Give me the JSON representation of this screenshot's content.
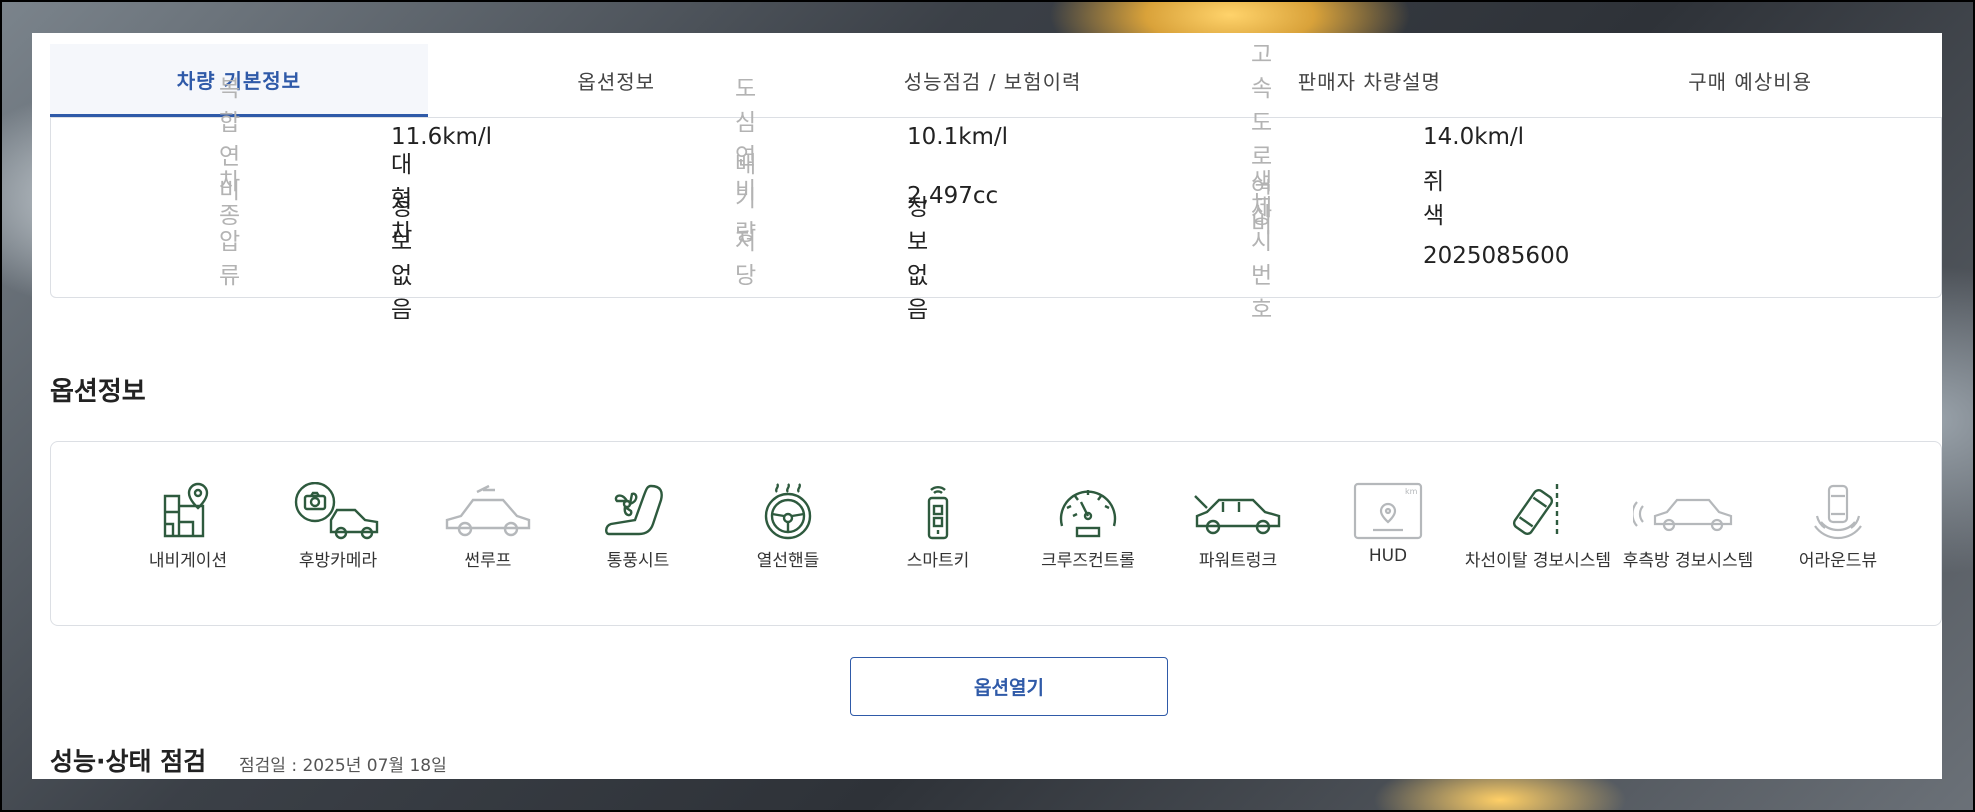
{
  "tabs": [
    {
      "label": "차량 기본정보",
      "active": true
    },
    {
      "label": "옵션정보",
      "active": false
    },
    {
      "label": "성능점검 / 보험이력",
      "active": false
    },
    {
      "label": "판매자 차량설명",
      "active": false
    },
    {
      "label": "구매 예상비용",
      "active": false
    }
  ],
  "specs": [
    [
      {
        "label": "복합연비",
        "value": "11.6km/l"
      },
      {
        "label": "도심연비",
        "value": "10.1km/l"
      },
      {
        "label": "고속도로연비",
        "value": "14.0km/l"
      }
    ],
    [
      {
        "label": "차종",
        "value": "대형차"
      },
      {
        "label": "배기량",
        "value": "2,497cc"
      },
      {
        "label": "색상",
        "value": "쥐색"
      }
    ],
    [
      {
        "label": "압류",
        "value": "정보없음"
      },
      {
        "label": "저당",
        "value": "정보없음"
      },
      {
        "label": "제시번호",
        "value": "2025085600"
      }
    ]
  ],
  "options_section": {
    "title": "옵션정보",
    "items": [
      {
        "label": "내비게이션",
        "icon": "navigation-icon",
        "enabled": true
      },
      {
        "label": "후방카메라",
        "icon": "rear-camera-icon",
        "enabled": true
      },
      {
        "label": "썬루프",
        "icon": "sunroof-icon",
        "enabled": false
      },
      {
        "label": "통풍시트",
        "icon": "ventilated-seat-icon",
        "enabled": true
      },
      {
        "label": "열선핸들",
        "icon": "heated-steering-icon",
        "enabled": true
      },
      {
        "label": "스마트키",
        "icon": "smart-key-icon",
        "enabled": true
      },
      {
        "label": "크루즈컨트롤",
        "icon": "cruise-control-icon",
        "enabled": true
      },
      {
        "label": "파워트렁크",
        "icon": "power-trunk-icon",
        "enabled": true
      },
      {
        "label": "HUD",
        "icon": "hud-icon",
        "enabled": false
      },
      {
        "label": "차선이탈 경보시스템",
        "icon": "lane-departure-icon",
        "enabled": true
      },
      {
        "label": "후측방 경보시스템",
        "icon": "blind-spot-icon",
        "enabled": false
      },
      {
        "label": "어라운드뷰",
        "icon": "around-view-icon",
        "enabled": false
      }
    ],
    "open_button": "옵션열기"
  },
  "inspection": {
    "title": "성능·상태 점검",
    "date": "점검일 : 2025년 07월 18일"
  },
  "colors": {
    "accent": "#2f5aa8",
    "icon_enabled": "#2e5a3e",
    "icon_disabled": "#b5b8bb"
  }
}
